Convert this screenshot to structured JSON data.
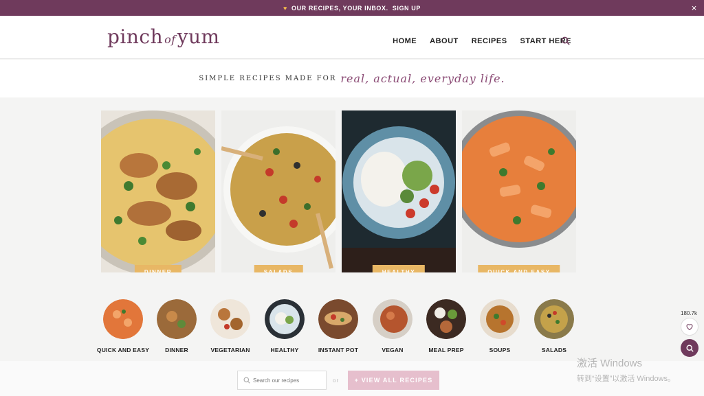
{
  "topbar": {
    "text": "OUR RECIPES, YOUR INBOX.",
    "link": "SIGN UP",
    "close": "×"
  },
  "header": {
    "logo_left": "pinch",
    "logo_of": "of",
    "logo_right": "yum",
    "nav": [
      "HOME",
      "ABOUT",
      "RECIPES",
      "START HERE"
    ]
  },
  "tagline": {
    "lead": "SIMPLE RECIPES MADE FOR",
    "script": "real, actual, everyday life."
  },
  "featured": [
    {
      "label": "DINNER"
    },
    {
      "label": "SALADS"
    },
    {
      "label": "HEALTHY"
    },
    {
      "label": "QUICK AND EASY"
    }
  ],
  "categories": [
    {
      "label": "QUICK AND EASY"
    },
    {
      "label": "DINNER"
    },
    {
      "label": "VEGETARIAN"
    },
    {
      "label": "HEALTHY"
    },
    {
      "label": "INSTANT POT"
    },
    {
      "label": "VEGAN"
    },
    {
      "label": "MEAL PREP"
    },
    {
      "label": "SOUPS"
    },
    {
      "label": "SALADS"
    }
  ],
  "search": {
    "placeholder": "Search our recipes",
    "or": "or",
    "view_all": "+ VIEW ALL RECIPES"
  },
  "favorites": {
    "count": "180.7k"
  },
  "watermark": {
    "line1": "激活 Windows",
    "line2": "转到“设置”以激活 Windows。"
  },
  "colors": {
    "brand": "#6f3a5c",
    "label": "#e8b765",
    "button": "#e6bfcd"
  }
}
